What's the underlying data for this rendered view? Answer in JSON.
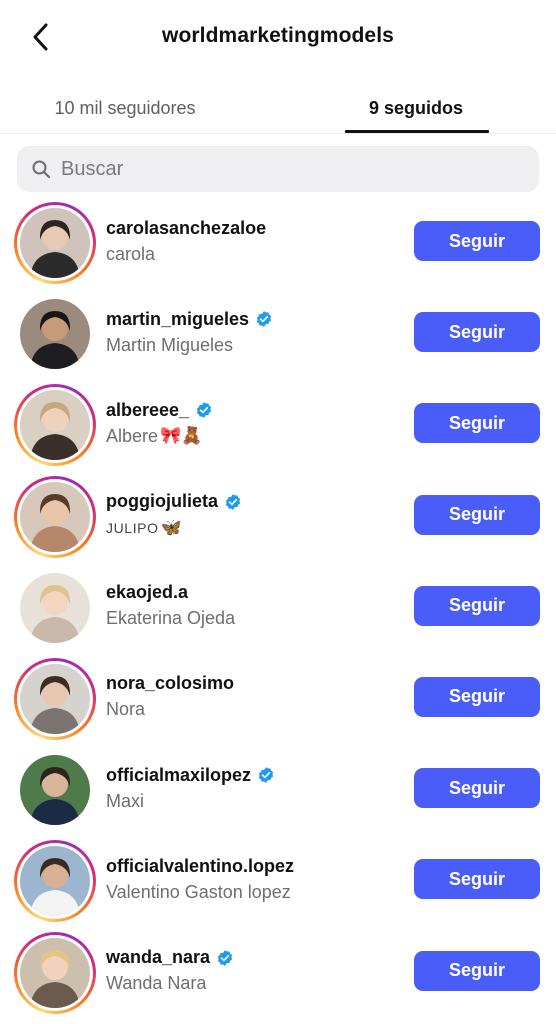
{
  "header": {
    "title": "worldmarketingmodels",
    "back_icon": "chevron-left-icon"
  },
  "tabs": [
    {
      "label": "10 mil seguidores",
      "active": false
    },
    {
      "label": "9 seguidos",
      "active": true
    }
  ],
  "search": {
    "placeholder": "Buscar",
    "value": "",
    "icon": "search-icon"
  },
  "colors": {
    "follow_button": "#4a5df9",
    "verified_badge": "#1d9bf0",
    "secondary_text": "#6e6e73",
    "search_bg": "#efeff2"
  },
  "accounts": [
    {
      "username": "carolasanchezaloe",
      "name": "carola",
      "verified": false,
      "story_ring": true,
      "button": "Seguir"
    },
    {
      "username": "martin_migueles",
      "name": "Martin Migueles",
      "verified": true,
      "story_ring": false,
      "button": "Seguir"
    },
    {
      "username": "albereee_",
      "name": "Albere",
      "name_emoji": "🎀🧸",
      "verified": true,
      "story_ring": true,
      "button": "Seguir"
    },
    {
      "username": "poggiojulieta",
      "name": "JULIPO",
      "name_emoji": "🦋",
      "verified": true,
      "story_ring": true,
      "button": "Seguir"
    },
    {
      "username": "ekaojed.a",
      "name": "Ekaterina Ojeda",
      "verified": false,
      "story_ring": false,
      "button": "Seguir"
    },
    {
      "username": "nora_colosimo",
      "name": "Nora",
      "verified": false,
      "story_ring": true,
      "button": "Seguir"
    },
    {
      "username": "officialmaxilopez",
      "name": "Maxi",
      "verified": true,
      "story_ring": false,
      "button": "Seguir"
    },
    {
      "username": "officialvalentino.lopez",
      "name": "Valentino Gaston lopez",
      "verified": false,
      "story_ring": true,
      "button": "Seguir"
    },
    {
      "username": "wanda_nara",
      "name": "Wanda Nara",
      "verified": true,
      "story_ring": true,
      "button": "Seguir"
    }
  ]
}
